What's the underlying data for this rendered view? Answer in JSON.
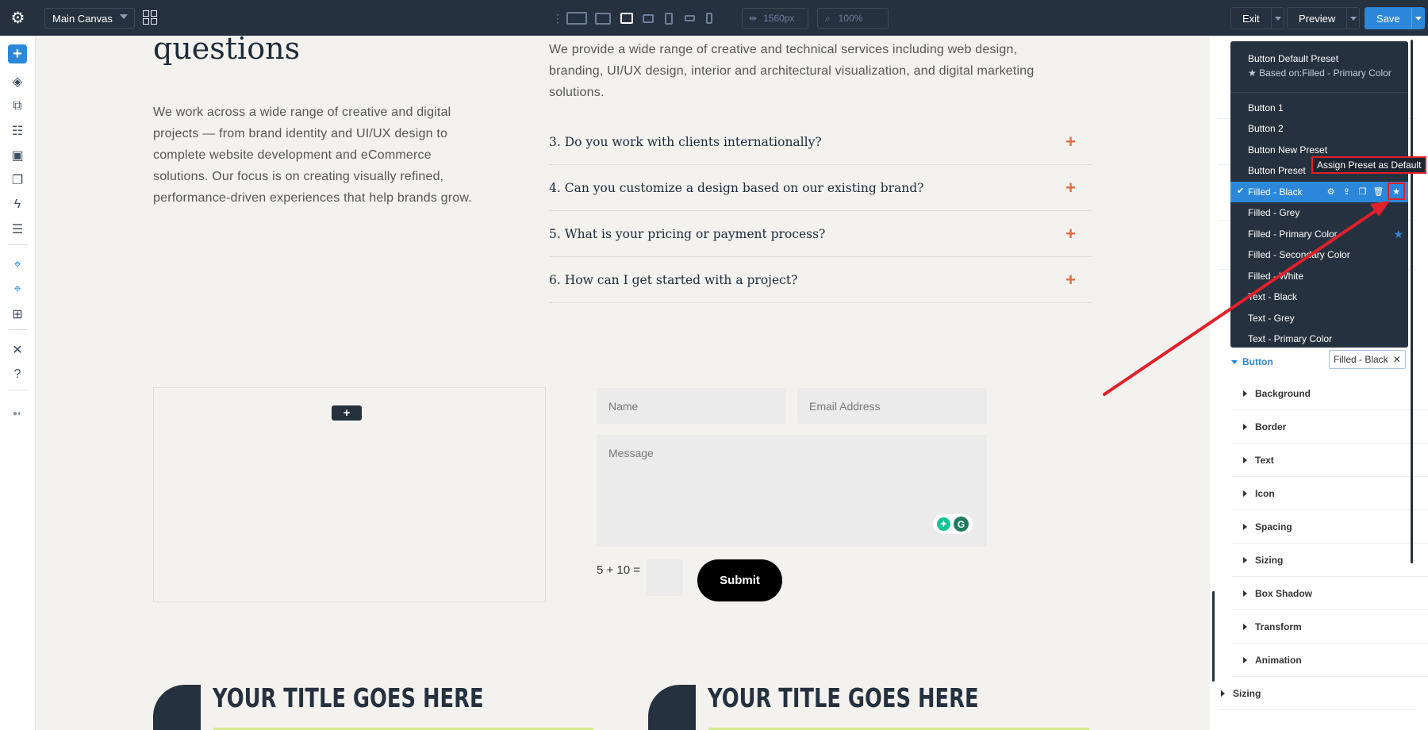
{
  "topbar": {
    "canvas_name": "Main Canvas",
    "width_value": "1560px",
    "zoom_value": "100%",
    "exit_label": "Exit",
    "preview_label": "Preview",
    "save_label": "Save",
    "active_device": "desktop-medium"
  },
  "canvas": {
    "heading": "questions",
    "intro": "We work across a wide range of creative and digital projects — from brand identity and UI/UX design to complete website development and eCommerce solutions. Our focus is on creating visually refined, performance-driven experiences that help brands grow.",
    "faq_answer": "We provide a wide range of creative and technical services including web design, branding, UI/UX design, interior and architectural visualization, and digital marketing solutions.",
    "faq_items": [
      "3. Do you work with clients internationally?",
      "4. Can you customize a design based on our existing brand?",
      "5. What is your pricing or payment process?",
      "6. How can I get started with a project?"
    ],
    "form": {
      "name_placeholder": "Name",
      "email_placeholder": "Email Address",
      "message_placeholder": "Message",
      "captcha": "5 + 10 =",
      "submit_label": "Submit"
    },
    "titles": [
      "YOUR TITLE GOES HERE",
      "YOUR TITLE GOES HERE"
    ]
  },
  "preset_dropdown": {
    "default_preset": "Button Default Preset",
    "based_on": "★ Based on:Filled - Primary Color",
    "items": [
      "Button 1",
      "Button 2",
      "Button New Preset",
      "Button Preset",
      "Filled - Black",
      "Filled - Grey",
      "Filled - Primary Color",
      "Filled - Secondary Color",
      "Filled - White",
      "Text - Black",
      "Text - Grey",
      "Text - Primary Color"
    ],
    "active_item": "Filled - Black",
    "default_item": "Filled - Primary Color",
    "tooltip": "Assign Preset as Default"
  },
  "right_panel": {
    "button_section": "Button",
    "current_preset": "Filled - Black",
    "groups": [
      "Background",
      "Border",
      "Text",
      "Icon",
      "Spacing",
      "Sizing",
      "Box Shadow",
      "Transform",
      "Animation"
    ],
    "bottom_group": "Sizing"
  },
  "colors": {
    "topbar": "#26313f",
    "accent": "#2b87da",
    "plus_accent": "#e86b3d",
    "highlight": "#e0202a",
    "title_underline": "#d6ea8f"
  }
}
